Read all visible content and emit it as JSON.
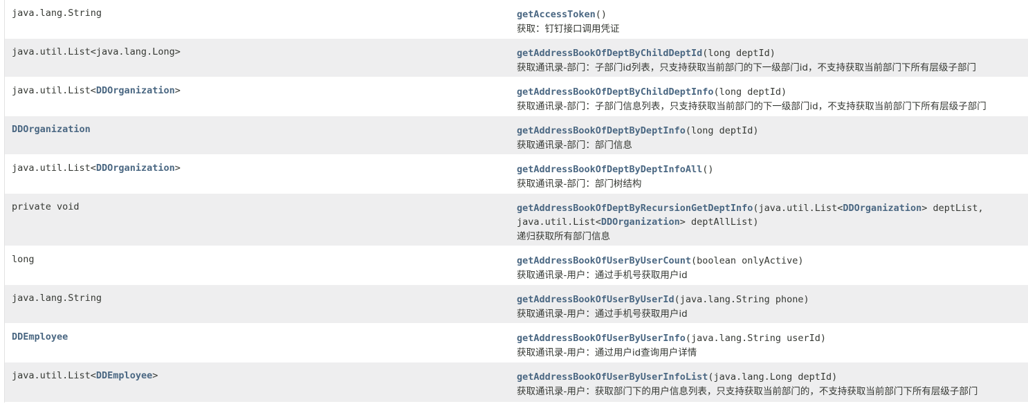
{
  "rows": [
    {
      "type": [
        {
          "t": "java.lang.String",
          "l": false
        }
      ],
      "method": "getAccessToken",
      "params": [
        {
          "t": "()",
          "l": false
        }
      ],
      "desc": "获取：钉钉接口调用凭证"
    },
    {
      "type": [
        {
          "t": "java.util.List<java.lang.Long>",
          "l": false
        }
      ],
      "method": "getAddressBookOfDeptByChildDeptId",
      "params": [
        {
          "t": "(long deptId)",
          "l": false
        }
      ],
      "desc": "获取通讯录-部门：子部门id列表，只支持获取当前部门的下一级部门id，不支持获取当前部门下所有层级子部门"
    },
    {
      "type": [
        {
          "t": "java.util.List<",
          "l": false
        },
        {
          "t": "DDOrganization",
          "l": true
        },
        {
          "t": ">",
          "l": false
        }
      ],
      "method": "getAddressBookOfDeptByChildDeptInfo",
      "params": [
        {
          "t": "(long deptId)",
          "l": false
        }
      ],
      "desc": "获取通讯录-部门：子部门信息列表，只支持获取当前部门的下一级部门id，不支持获取当前部门下所有层级子部门"
    },
    {
      "type": [
        {
          "t": "DDOrganization",
          "l": true
        }
      ],
      "method": "getAddressBookOfDeptByDeptInfo",
      "params": [
        {
          "t": "(long deptId)",
          "l": false
        }
      ],
      "desc": "获取通讯录-部门：部门信息"
    },
    {
      "type": [
        {
          "t": "java.util.List<",
          "l": false
        },
        {
          "t": "DDOrganization",
          "l": true
        },
        {
          "t": ">",
          "l": false
        }
      ],
      "method": "getAddressBookOfDeptByDeptInfoAll",
      "params": [
        {
          "t": "()",
          "l": false
        }
      ],
      "desc": "获取通讯录-部门：部门树结构"
    },
    {
      "type": [
        {
          "t": "private void",
          "l": false
        }
      ],
      "method": "getAddressBookOfDeptByRecursionGetDeptInfo",
      "params": [
        {
          "t": "(java.util.List<",
          "l": false
        },
        {
          "t": "DDOrganization",
          "l": true
        },
        {
          "t": "> deptList,",
          "l": false
        },
        {
          "t": "\n",
          "l": false
        },
        {
          "t": "java.util.List<",
          "l": false
        },
        {
          "t": "DDOrganization",
          "l": true
        },
        {
          "t": "> deptAllList)",
          "l": false
        }
      ],
      "desc": "递归获取所有部门信息"
    },
    {
      "type": [
        {
          "t": "long",
          "l": false
        }
      ],
      "method": "getAddressBookOfUserByUserCount",
      "params": [
        {
          "t": "(boolean onlyActive)",
          "l": false
        }
      ],
      "desc": "获取通讯录-用户：通过手机号获取用户id"
    },
    {
      "type": [
        {
          "t": "java.lang.String",
          "l": false
        }
      ],
      "method": "getAddressBookOfUserByUserId",
      "params": [
        {
          "t": "(java.lang.String phone)",
          "l": false
        }
      ],
      "desc": "获取通讯录-用户：通过手机号获取用户id"
    },
    {
      "type": [
        {
          "t": "DDEmployee",
          "l": true
        }
      ],
      "method": "getAddressBookOfUserByUserInfo",
      "params": [
        {
          "t": "(java.lang.String userId)",
          "l": false
        }
      ],
      "desc": "获取通讯录-用户：通过用户id查询用户详情"
    },
    {
      "type": [
        {
          "t": "java.util.List<",
          "l": false
        },
        {
          "t": "DDEmployee",
          "l": true
        },
        {
          "t": ">",
          "l": false
        }
      ],
      "method": "getAddressBookOfUserByUserInfoList",
      "params": [
        {
          "t": "(java.lang.Long deptId)",
          "l": false
        }
      ],
      "desc": "获取通讯录-用户：获取部门下的用户信息列表，只支持获取当前部门的，不支持获取当前部门下所有层级子部门"
    }
  ]
}
